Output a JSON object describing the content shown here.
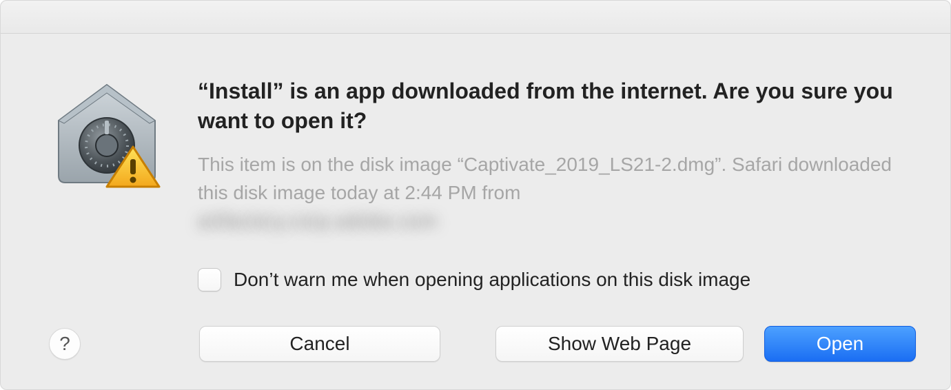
{
  "dialog": {
    "heading": "“Install” is an app downloaded from the internet. Are you sure you want to open it?",
    "subtext_line": "This item is on the disk image “Captivate_2019_LS21-2.dmg”. Safari downloaded this disk image today at 2:44 PM from",
    "subtext_source_redacted": "artfactory.corp.adobe.com",
    "checkbox_label": "Don’t warn me when opening applications on this disk image",
    "buttons": {
      "help_label": "?",
      "cancel": "Cancel",
      "show_web_page": "Show Web Page",
      "open": "Open"
    },
    "icons": {
      "gatekeeper": "gatekeeper-security-icon",
      "warning": "warning-triangle-icon"
    }
  }
}
